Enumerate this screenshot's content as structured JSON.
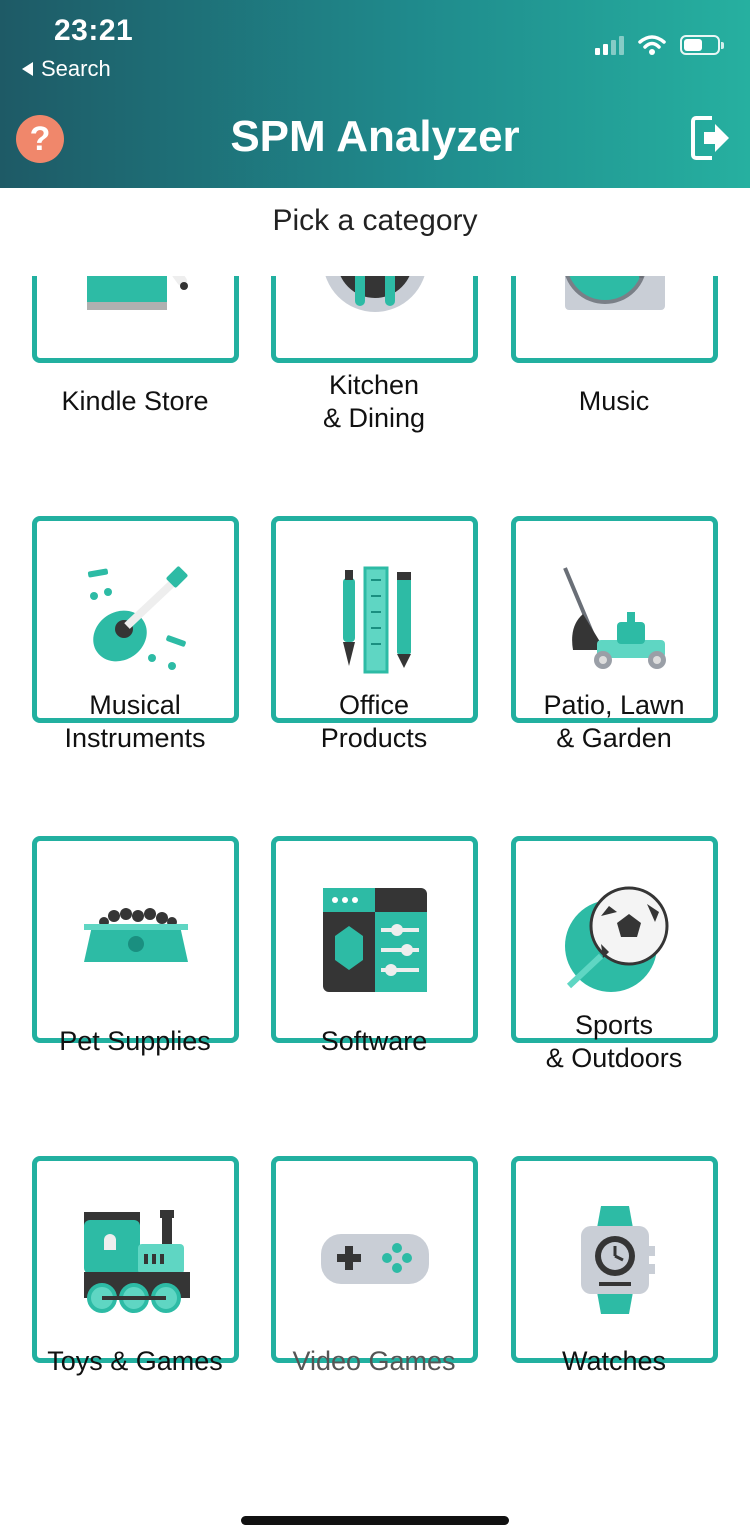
{
  "status_bar": {
    "time": "23:21",
    "back_label": "Search"
  },
  "header": {
    "title": "SPM Analyzer",
    "help_label": "?"
  },
  "subtitle": "Pick a category",
  "colors": {
    "accent": "#22b0a0",
    "help": "#f0876b",
    "header_start": "#1e5a66",
    "header_end": "#26b0a0"
  },
  "categories": [
    {
      "label": "Kindle Store",
      "icon": "kindle-icon"
    },
    {
      "label": "Kitchen\n& Dining",
      "icon": "kitchen-dining-icon"
    },
    {
      "label": "Music",
      "icon": "turntable-icon"
    },
    {
      "label": "Musical\nInstruments",
      "icon": "guitar-icon"
    },
    {
      "label": "Office\nProducts",
      "icon": "office-products-icon"
    },
    {
      "label": "Patio, Lawn\n& Garden",
      "icon": "lawn-mower-icon"
    },
    {
      "label": "Pet Supplies",
      "icon": "pet-bowl-icon"
    },
    {
      "label": "Software",
      "icon": "software-icon"
    },
    {
      "label": "Sports\n& Outdoors",
      "icon": "soccer-ball-icon"
    },
    {
      "label": "Toys & Games",
      "icon": "toy-train-icon"
    },
    {
      "label": "Video Games",
      "icon": "gamepad-icon"
    },
    {
      "label": "Watches",
      "icon": "watch-icon"
    }
  ]
}
